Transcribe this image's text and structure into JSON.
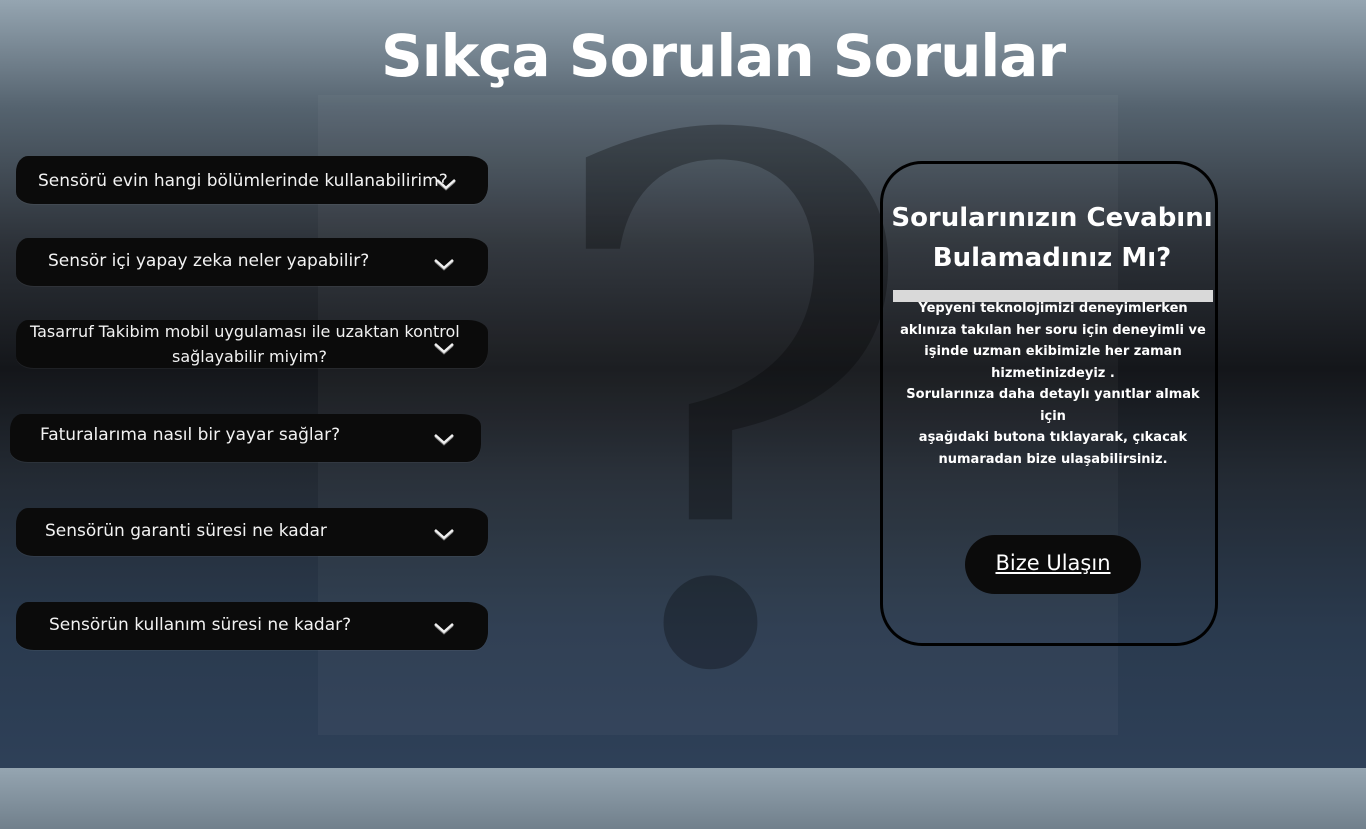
{
  "page": {
    "title": "Sıkça Sorulan Sorular"
  },
  "faq": {
    "items": [
      {
        "question": "Sensörü evin hangi bölümlerinde kullanabilirim?"
      },
      {
        "question": "Sensör içi yapay zeka neler yapabilir?"
      },
      {
        "question_line1": "Tasarruf Takibim mobil uygulaması ile  uzaktan kontrol",
        "question_line2": "sağlayabilir miyim?"
      },
      {
        "question": "Faturalarıma nasıl bir yayar sağlar?"
      },
      {
        "question": "Sensörün garanti süresi ne kadar"
      },
      {
        "question": "Sensörün kullanım süresi ne kadar?"
      }
    ],
    "expand_icon": "chevron-down-icon"
  },
  "contact_panel": {
    "title": "Sorularınızın Cevabını Bulamadınız Mı?",
    "text_line1": "Yepyeni teknolojimizi deneyimlerken",
    "text_line2": "aklınıza takılan her soru için deneyimli ve",
    "text_line3": "işinde uzman ekibimizle her zaman",
    "text_line4": "hizmetinizdeyiz .",
    "text_line5": "Sorularınıza daha detaylı yanıtlar almak için",
    "text_line6": "aşağıdaki butona tıklayarak, çıkacak",
    "text_line7": "numaradan bize ulaşabilirsiniz.",
    "button_label": "Bize Ulaşın"
  },
  "colors": {
    "item_background": "#0b0b0b",
    "text": "#ffffff",
    "divider": "#d9d9d9"
  }
}
